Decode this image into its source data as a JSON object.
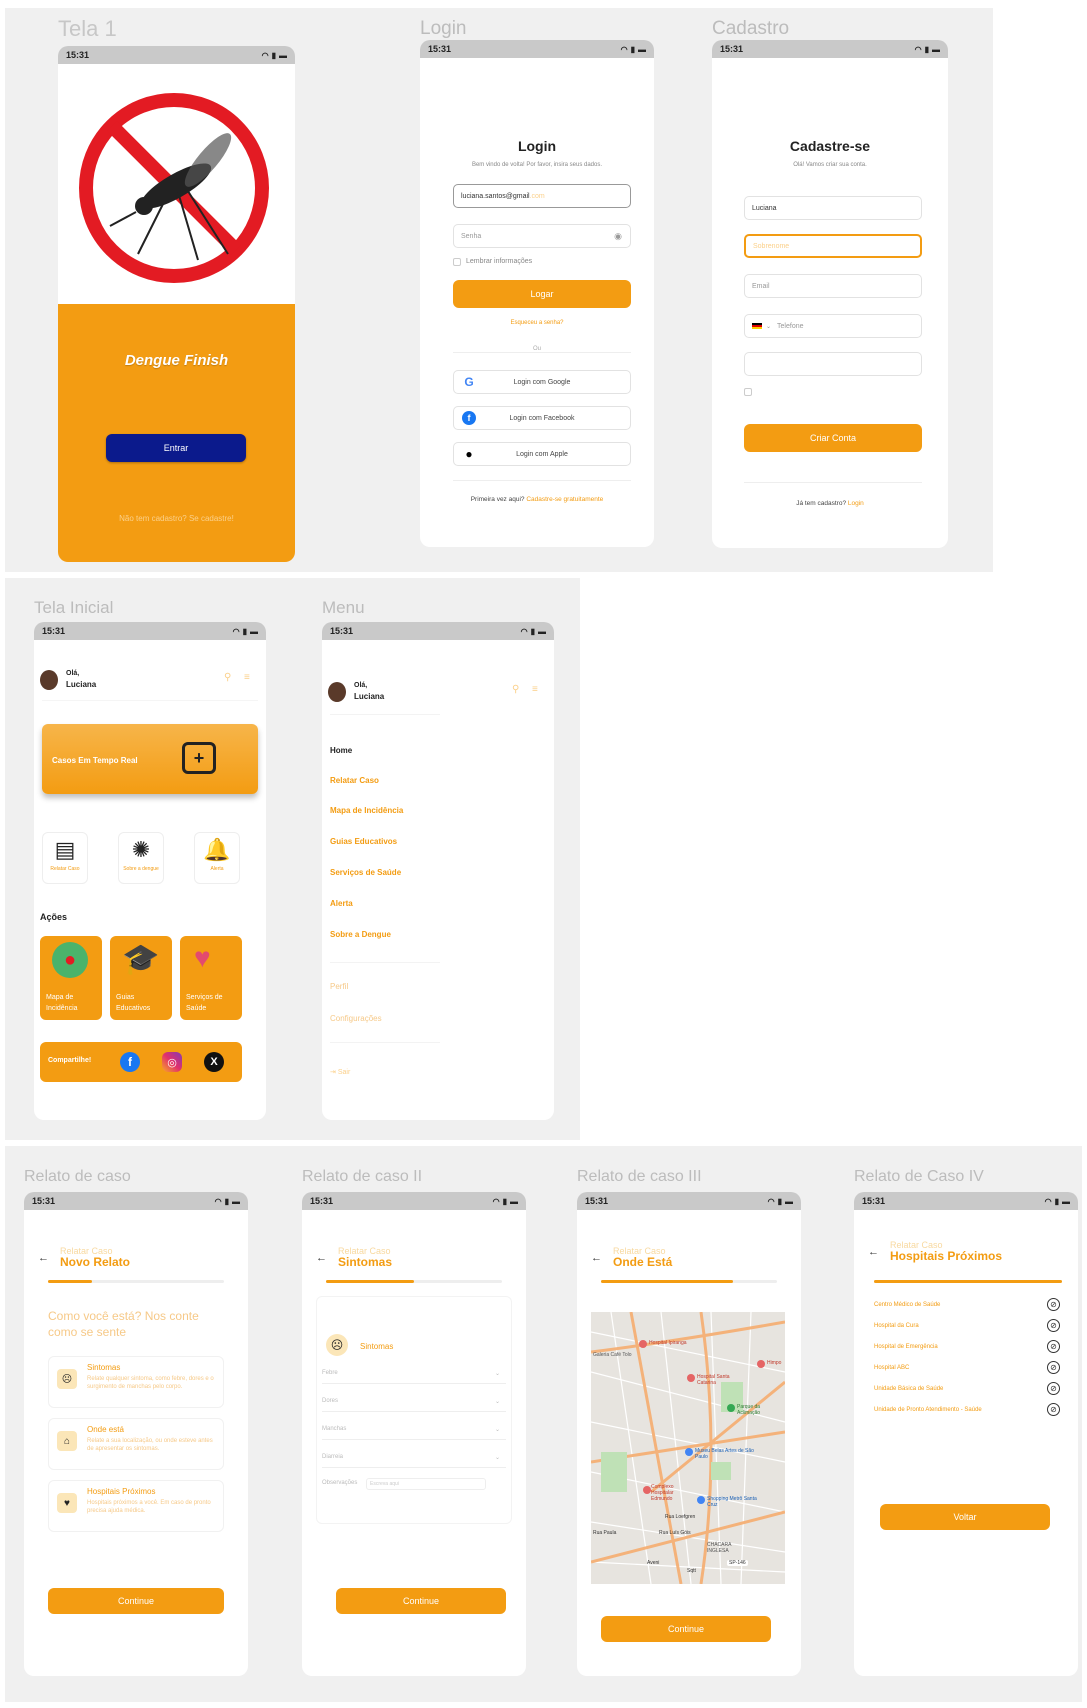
{
  "status_time": "15:31",
  "frames": {
    "tela1": "Tela 1",
    "login": "Login",
    "cadastro": "Cadastro",
    "tela_inicial": "Tela Inicial",
    "menu": "Menu",
    "relato1": "Relato de caso",
    "relato2": "Relato de caso II",
    "relato3": "Relato de caso III",
    "relato4": "Relato de Caso IV"
  },
  "splash": {
    "app_name": "Dengue Finish",
    "enter_button": "Entrar",
    "signup_link": "Não tem cadastro? Se cadastre!",
    "colors": {
      "orange": "#f39c12",
      "button": "#0b1a8c"
    }
  },
  "login": {
    "title": "Login",
    "subtitle": "Bem vindo de volta! Por favor, insira seus dados.",
    "email_value": "luciana.santos@gmail",
    "email_suffix": ".com",
    "password_placeholder": "Senha",
    "remember": "Lembrar informações",
    "login_button": "Logar",
    "forgot": "Esqueceu a senha?",
    "or": "Ou",
    "google": "Login com Google",
    "facebook": "Login com Facebook",
    "apple": "Login com Apple",
    "first_time": "Primeira vez aqui?",
    "signup_free": "Cadastre-se gratuitamente"
  },
  "cadastro": {
    "title": "Cadastre-se",
    "subtitle": "Olá! Vamos criar sua conta.",
    "name_value": "Luciana",
    "surname_placeholder": "Sobrenome",
    "email_placeholder": "Email",
    "phone_placeholder": "Telefone",
    "create_button": "Criar Conta",
    "has_account": "Já tem cadastro?",
    "login_link": "Login"
  },
  "home": {
    "greeting": "Olá,",
    "user": "Luciana",
    "banner": "Casos Em Tempo Real",
    "quick": [
      "Relatar Caso",
      "Sobre a dengue",
      "Alerta"
    ],
    "actions_title": "Ações",
    "cat1": [
      "Mapa de",
      "Incidência"
    ],
    "cat2": [
      "Guias",
      "Educativos"
    ],
    "cat3": [
      "Serviços de",
      "Saúde"
    ],
    "share": "Compartilhe!"
  },
  "menu": {
    "greeting": "Olá,",
    "user": "Luciana",
    "items": [
      "Home",
      "Relatar Caso",
      "Mapa de Incidência",
      "Guias Educativos",
      "Serviços de Saúde",
      "Alerta",
      "Sobre a Dengue"
    ],
    "profile": "Perfil",
    "settings": "Configurações",
    "logout": "Sair"
  },
  "relato1": {
    "small": "Relatar Caso",
    "big": "Novo Relato",
    "progress": 0.25,
    "question": "Como você está? Nos conte como se sente",
    "cards": [
      {
        "title": "Sintomas",
        "desc": "Relate qualquer sintoma, como febre, dores e o surgimento de manchas pelo corpo."
      },
      {
        "title": "Onde está",
        "desc": "Relate a sua localização, ou onde esteve antes de apresentar os sintomas."
      },
      {
        "title": "Hospitais Próximos",
        "desc": "Hospitais próximos a você. Em caso de pronto precisa ajuda médica."
      }
    ],
    "button": "Continue"
  },
  "relato2": {
    "small": "Relatar Caso",
    "big": "Sintomas",
    "progress": 0.5,
    "section": "Sintomas",
    "rows": [
      "Febre",
      "Dores",
      "Manchas",
      "Diarreia"
    ],
    "obs_label": "Observações",
    "obs_placeholder": "Escreva aqui",
    "button": "Continue"
  },
  "relato3": {
    "small": "Relatar Caso",
    "big": "Onde Está",
    "progress": 0.75,
    "map_labels": [
      "Hospital Ipiranga",
      "Galeria Café Tolo",
      "Hospital Santa Catarina",
      "Parque da Aclimação",
      "Museu Belas Artes de São Paulo",
      "Complexo Hospitalar Edmundo",
      "Shopping Metrô Santa Cruz",
      "Rua Loefgren",
      "Rua Luís Góis",
      "CHÁCARA INGLESA",
      "Rua Paula",
      "Aveni",
      "Sqtt",
      "SP-146",
      "Himpo"
    ],
    "button": "Continue"
  },
  "relato4": {
    "small": "Relatar Caso",
    "big": "Hospitais Próximos",
    "progress": 1,
    "hospitals": [
      "Centro Médico de Saúde",
      "Hospital da Cura",
      "Hospital de Emergência",
      "Hospital ABC",
      "Unidade Básica de Saúde",
      "Unidade de Pronto Atendimento - Saúde"
    ],
    "button": "Voltar"
  }
}
